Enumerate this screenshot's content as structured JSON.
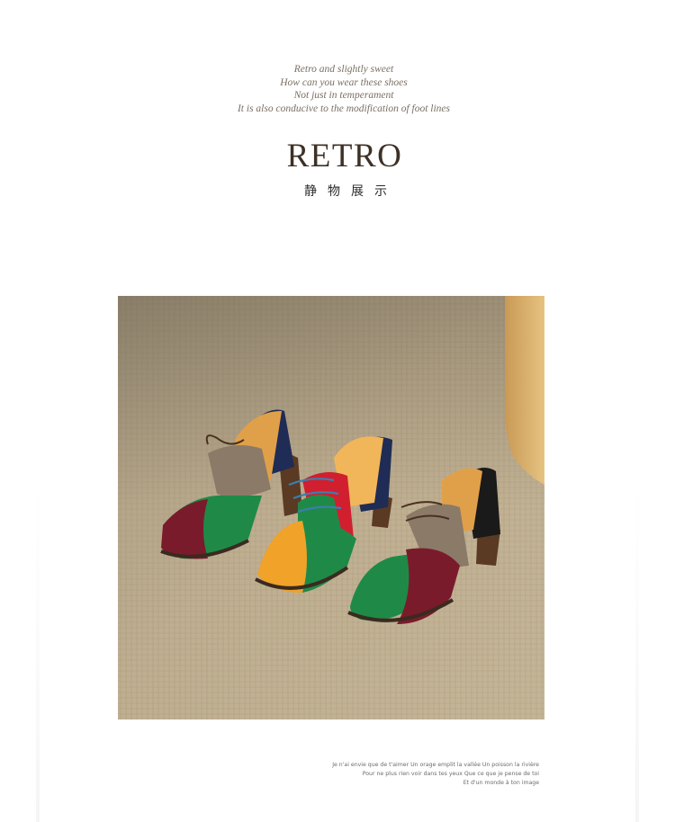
{
  "intro": {
    "lines": [
      "Retro and slightly sweet",
      "How can you wear these shoes",
      "Not just in temperament",
      "It is also conducive to the modification of foot lines"
    ]
  },
  "title": "RETRO",
  "subtitle": "静物展示",
  "photo": {
    "icon": "product-photo",
    "colors": {
      "carpet": "#b8a88a",
      "burgundy": "#7a1b2c",
      "green": "#1f8a47",
      "navy": "#1f2c55",
      "taupe": "#8c7a68",
      "orange": "#f0a229",
      "red": "#d11f2f",
      "blue_lace": "#3a7fb3",
      "black": "#1a1a1a"
    }
  },
  "caption": {
    "lines": [
      "Je n'ai envie que de t'aimer Un orage emplit la vallée Un poisson la rivière",
      "Pour ne plus rien voir dans tes yeux Que ce que je pense de toi",
      "Et d'un monde à ton image"
    ]
  }
}
